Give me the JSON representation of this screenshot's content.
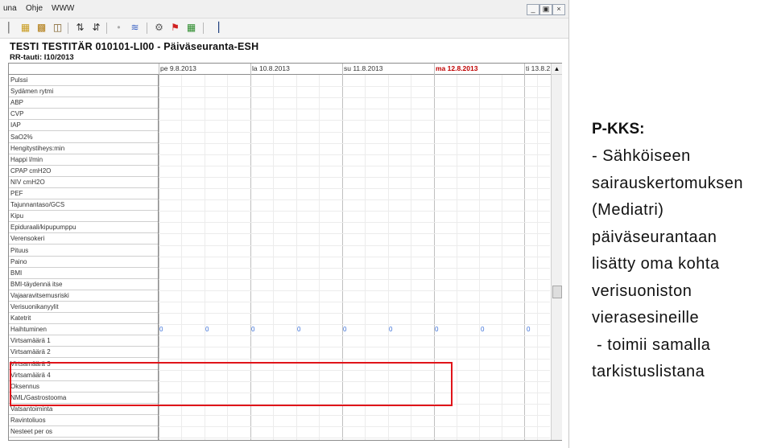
{
  "menu": {
    "items": [
      "una",
      "Ohje",
      "WWW"
    ]
  },
  "window_controls": {
    "minimize": "_",
    "restore": "×",
    "close": "×"
  },
  "title": {
    "patient": "TESTI TESTITÄR 010101-LI00 - Päiväseuranta-ESH",
    "subtitle": "RR-tauti: I10/2013"
  },
  "dates": [
    {
      "label": "pe 9.8.2013",
      "today": false
    },
    {
      "label": "la 10.8.2013",
      "today": false
    },
    {
      "label": "su 11.8.2013",
      "today": false
    },
    {
      "label": "ma 12.8.2013",
      "today": true
    },
    {
      "label": "ti 13.8.2",
      "today": false
    }
  ],
  "rows": [
    "Pulssi",
    "Sydämen rytmi",
    "ABP",
    "CVP",
    "IAP",
    "SaO2%",
    "Hengitystiheys:min",
    "Happi l/min",
    "CPAP cmH2O",
    "NIV cmH2O",
    "PEF",
    "Tajunnantaso/GCS",
    "Kipu",
    "Epiduraali/kipupumppu",
    "Verensokeri",
    "Pituus",
    "Paino",
    "BMI",
    "BMI-täydennä itse",
    "Vajaaravitsemusriski",
    "Verisuonikanyylit",
    "Katetrit",
    "Haihtuminen",
    "Virtsamäärä 1",
    "Virtsamäärä 2",
    "Virtsamäärä 3",
    "Virtsamäärä 4",
    "Oksennus",
    "NML/Gastrostooma",
    "Vatsantoiminta",
    "Ravintoliuos",
    "Nesteet per os"
  ],
  "haihtuminen_values": [
    "0",
    "0",
    "0",
    "0",
    "0",
    "0",
    "0",
    "0",
    "0"
  ],
  "annotation": {
    "heading": "P-KKS:",
    "lines": [
      "- Sähköiseen",
      "sairauskertomuksen",
      "(Mediatri)",
      "päiväseurantaan",
      "lisätty oma kohta",
      "verisuoniston",
      "vierasesineille",
      " - toimii samalla",
      "tarkistuslistana"
    ]
  },
  "colors": {
    "highlight": "#e0141a",
    "today": "#c00000",
    "values": "#3a6fd8"
  }
}
